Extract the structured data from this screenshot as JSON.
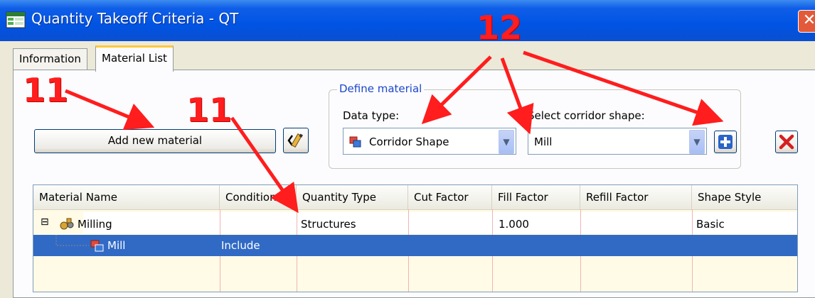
{
  "window": {
    "title": "Quantity Takeoff Criteria - QT",
    "close_glyph": "✕"
  },
  "tabs": [
    {
      "label": "Information",
      "active": false
    },
    {
      "label": "Material List",
      "active": true
    }
  ],
  "toolbar": {
    "add_material_label": "Add new material"
  },
  "define_material": {
    "legend": "Define material",
    "data_type_label": "Data type:",
    "data_type_value": "Corridor Shape",
    "corridor_shape_label": "Select corridor shape:",
    "corridor_shape_value": "Mill"
  },
  "grid": {
    "columns": [
      "Material Name",
      "Condition",
      "Quantity Type",
      "Cut Factor",
      "Fill Factor",
      "Refill Factor",
      "Shape Style"
    ],
    "rows": [
      {
        "expander": "⊟",
        "name": "Milling",
        "condition": "",
        "quantity_type": "Structures",
        "cut_factor": "",
        "fill_factor": "1.000",
        "refill_factor": "",
        "shape_style": "Basic"
      },
      {
        "name": "Mill",
        "condition": "Include",
        "quantity_type": "",
        "cut_factor": "",
        "fill_factor": "",
        "refill_factor": "",
        "shape_style": ""
      }
    ]
  },
  "annotations": {
    "label_11": "11",
    "label_12": "12"
  },
  "colors": {
    "annotation": "#ff1d1d",
    "selection": "#316ac5",
    "titlebar": "#0054e3"
  }
}
